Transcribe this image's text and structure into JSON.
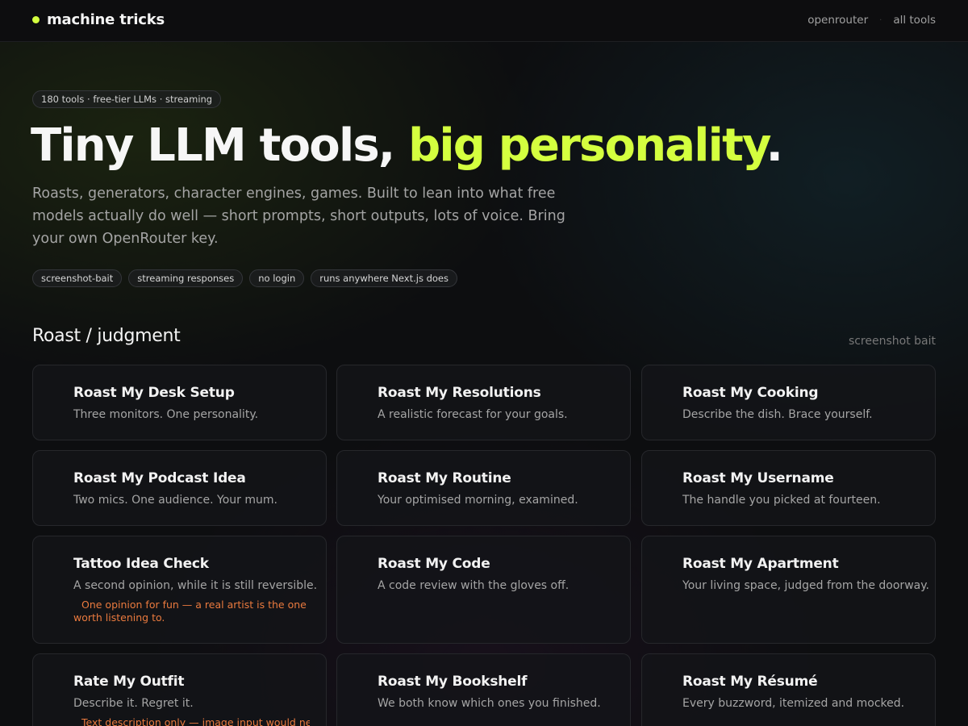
{
  "header": {
    "brand": "machine tricks",
    "nav": [
      "openrouter",
      "all tools"
    ],
    "accent_color": "#d4ff3f"
  },
  "hero": {
    "badge": "180 tools · free-tier LLMs · streaming",
    "headline_main": "Tiny LLM tools, ",
    "headline_accent": "big personality",
    "headline_end": ".",
    "lede": "Roasts, generators, character engines, games. Built to lean into what free models actually do well — short prompts, short outputs, lots of voice. Bring your own OpenRouter key.",
    "tags": [
      "screenshot-bait",
      "streaming responses",
      "no login",
      "runs anywhere Next.js does"
    ]
  },
  "section": {
    "title": "Roast / judgment",
    "note": "screenshot bait"
  },
  "cards": [
    {
      "title": "Roast My Desk Setup",
      "desc": "Three monitors. One personality."
    },
    {
      "title": "Roast My Resolutions",
      "desc": "A realistic forecast for your goals."
    },
    {
      "title": "Roast My Cooking",
      "desc": "Describe the dish. Brace yourself."
    },
    {
      "title": "Roast My Podcast Idea",
      "desc": "Two mics. One audience. Your mum."
    },
    {
      "title": "Roast My Routine",
      "desc": "Your optimised morning, examined."
    },
    {
      "title": "Roast My Username",
      "desc": "The handle you picked at fourteen."
    },
    {
      "title": "Tattoo Idea Check",
      "desc": "A second opinion, while it is still reversible.",
      "warning": "One opinion for fun — a real artist is the one worth listening to."
    },
    {
      "title": "Roast My Code",
      "desc": "A code review with the gloves off."
    },
    {
      "title": "Roast My Apartment",
      "desc": "Your living space, judged from the doorway."
    },
    {
      "title": "Rate My Outfit",
      "desc": "Describe it. Regret it.",
      "warning": "Text description only — image input would need a"
    },
    {
      "title": "Roast My Bookshelf",
      "desc": "We both know which ones you finished."
    },
    {
      "title": "Roast My Résumé",
      "desc": "Every buzzword, itemized and mocked."
    }
  ]
}
